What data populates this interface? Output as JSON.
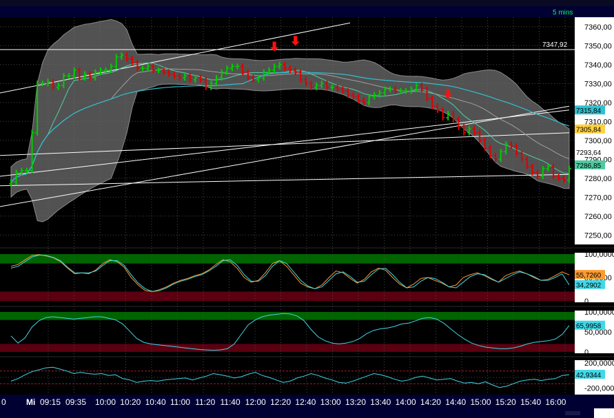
{
  "header": {
    "interval": "5 mins"
  },
  "colors": {
    "background": "#000000",
    "header_bar": "#000033",
    "axis_panel": "#ffffff",
    "bollinger_band": "#6e6e6e",
    "up_bar": "#00cc00",
    "down_bar": "#e00000",
    "ma_fast": "#50c8a0",
    "ma_mid": "#a0a0a0",
    "ma_slow": "#30c0d0",
    "trendline": "#ffffff",
    "osc_line_1": "#ff9a2e",
    "osc_line_2": "#40d8e8",
    "overbought_zone": "#006400",
    "oversold_zone": "#5a0010",
    "arrow": "#ff1010"
  },
  "time_axis": {
    "day_label": "Mi",
    "labels": [
      "09:15",
      "09:35",
      "10:00",
      "10:20",
      "10:40",
      "11:00",
      "11:20",
      "11:40",
      "12:00",
      "12:20",
      "12:40",
      "13:00",
      "13:20",
      "13:40",
      "14:00",
      "14:20",
      "14:40",
      "15:00",
      "15:20",
      "15:40",
      "16:00"
    ],
    "left_partial": "0"
  },
  "chart_data": [
    {
      "type": "ohlc",
      "pane": "price",
      "ylim": [
        7245,
        7365
      ],
      "y_ticks": [
        "7250,00",
        "7260,00",
        "7270,00",
        "7280,00",
        "7290,00",
        "7300,00",
        "7310,00",
        "7320,00",
        "7330,00",
        "7340,00",
        "7350,00",
        "7360,00"
      ],
      "price_labels": [
        {
          "text": "7347,92",
          "value": 7347.92
        },
        {
          "text": "7315,84",
          "value": 7315.84,
          "bg": "#30c0d0"
        },
        {
          "text": "7305,84",
          "value": 7305.84,
          "bg": "#ffd040"
        },
        {
          "text": "7293,64",
          "value": 7293.64,
          "bg": "#ffffff"
        },
        {
          "text": "7286,85",
          "value": 7286.85,
          "bg": "#50c8a0"
        }
      ],
      "horizontal_line": 7347.92,
      "close": [
        7278,
        7283,
        7284,
        7284,
        7304,
        7330,
        7330,
        7331,
        7328,
        7329,
        7334,
        7334,
        7337,
        7333,
        7335,
        7333,
        7336,
        7337,
        7337,
        7339,
        7344,
        7345,
        7343,
        7341,
        7338,
        7338,
        7339,
        7337,
        7337,
        7336,
        7335,
        7334,
        7333,
        7334,
        7332,
        7333,
        7332,
        7328,
        7330,
        7333,
        7336,
        7338,
        7339,
        7339,
        7336,
        7333,
        7332,
        7333,
        7336,
        7337,
        7339,
        7340,
        7338,
        7337,
        7336,
        7332,
        7330,
        7328,
        7329,
        7330,
        7328,
        7328,
        7327,
        7326,
        7324,
        7323,
        7321,
        7320,
        7323,
        7324,
        7325,
        7327,
        7327,
        7326,
        7326,
        7326,
        7327,
        7329,
        7327,
        7322,
        7318,
        7316,
        7312,
        7314,
        7311,
        7307,
        7304,
        7306,
        7304,
        7300,
        7296,
        7292,
        7290,
        7294,
        7298,
        7297,
        7293,
        7290,
        7286,
        7283,
        7281,
        7285,
        7286,
        7281,
        7280,
        7279,
        7285
      ],
      "arrows_down": [
        {
          "index": 50,
          "value": 7347
        },
        {
          "index": 54,
          "value": 7350
        },
        {
          "index": 83,
          "value": 7322
        }
      ]
    },
    {
      "type": "line",
      "pane": "stochastic",
      "ylim": [
        0,
        100
      ],
      "y_ticks": [
        "100,0000",
        "50,0000",
        "0"
      ],
      "zones": {
        "overbought": [
          80,
          100
        ],
        "oversold": [
          0,
          20
        ]
      },
      "series": [
        {
          "values": [
            74,
            78,
            88,
            97,
            99,
            96,
            92,
            84,
            70,
            58,
            60,
            58,
            66,
            80,
            88,
            84,
            72,
            50,
            34,
            22,
            20,
            24,
            30,
            38,
            44,
            48,
            54,
            58,
            66,
            78,
            88,
            84,
            70,
            50,
            40,
            44,
            60,
            80,
            86,
            74,
            56,
            38,
            30,
            26,
            34,
            50,
            64,
            60,
            48,
            38,
            46,
            62,
            70,
            66,
            50,
            36,
            28,
            36,
            48,
            50,
            44,
            38,
            30,
            34,
            50,
            56,
            60,
            54,
            46,
            40,
            54,
            60,
            64,
            58,
            50,
            44,
            46,
            54,
            62,
            55.726
          ]
        },
        {
          "values": [
            70,
            74,
            84,
            94,
            98,
            97,
            93,
            86,
            72,
            60,
            60,
            60,
            64,
            76,
            86,
            86,
            76,
            56,
            38,
            26,
            20,
            22,
            28,
            36,
            42,
            46,
            52,
            56,
            64,
            74,
            86,
            88,
            76,
            56,
            42,
            42,
            54,
            74,
            86,
            80,
            62,
            44,
            32,
            26,
            30,
            44,
            58,
            62,
            52,
            40,
            42,
            56,
            68,
            70,
            56,
            40,
            28,
            30,
            42,
            50,
            48,
            40,
            30,
            28,
            40,
            52,
            58,
            56,
            48,
            40,
            48,
            56,
            62,
            58,
            52,
            44,
            44,
            50,
            58,
            34.2902
          ]
        }
      ],
      "value_labels": [
        {
          "text": "55,7260",
          "value": 55.726,
          "bg": "#ff9a2e"
        },
        {
          "text": "34,2902",
          "value": 34.2902,
          "bg": "#40d8e8"
        }
      ]
    },
    {
      "type": "line",
      "pane": "rsi",
      "ylim": [
        0,
        100
      ],
      "y_ticks": [
        "100,0000",
        "50,0000",
        "0"
      ],
      "zones": {
        "overbought": [
          80,
          100
        ],
        "oversold": [
          0,
          20
        ]
      },
      "series": [
        {
          "values": [
            40,
            22,
            35,
            62,
            78,
            86,
            88,
            86,
            84,
            82,
            84,
            86,
            88,
            88,
            84,
            80,
            70,
            52,
            34,
            24,
            20,
            18,
            16,
            14,
            12,
            10,
            8,
            6,
            5,
            4,
            5,
            8,
            20,
            44,
            68,
            80,
            88,
            92,
            94,
            96,
            95,
            90,
            78,
            56,
            38,
            28,
            22,
            20,
            22,
            26,
            34,
            46,
            54,
            58,
            60,
            64,
            70,
            72,
            78,
            84,
            86,
            82,
            72,
            58,
            44,
            32,
            22,
            16,
            12,
            10,
            8,
            8,
            10,
            14,
            20,
            24,
            26,
            28,
            32,
            44,
            65.9958
          ]
        }
      ],
      "value_labels": [
        {
          "text": "65,9958",
          "value": 65.9958,
          "bg": "#40d8e8"
        }
      ]
    },
    {
      "type": "line",
      "pane": "cci",
      "ylim": [
        -250,
        250
      ],
      "y_ticks": [
        "200,0000",
        "0",
        "-200,0000"
      ],
      "zones": {
        "upper": 100,
        "lower": -100
      },
      "series": [
        {
          "values": [
            -60,
            -20,
            40,
            90,
            120,
            150,
            160,
            130,
            100,
            60,
            80,
            60,
            50,
            60,
            30,
            40,
            -20,
            -40,
            -80,
            -60,
            -50,
            -60,
            -40,
            -30,
            -20,
            -10,
            -40,
            -10,
            20,
            60,
            40,
            20,
            -10,
            10,
            50,
            80,
            30,
            0,
            -40,
            -80,
            -60,
            -10,
            20,
            60,
            30,
            -10,
            -40,
            -80,
            -90,
            -60,
            -20,
            20,
            60,
            40,
            10,
            -30,
            -60,
            -40,
            0,
            20,
            -10,
            -40,
            -30,
            -20,
            -60,
            -90,
            -80,
            -100,
            -70,
            -120,
            -160,
            -140,
            -100,
            -60,
            -40,
            -30,
            -50,
            -30,
            -20,
            30,
            42.9344
          ]
        }
      ],
      "value_labels": [
        {
          "text": "42,9344",
          "value": 42.9344,
          "bg": "#40d8e8"
        }
      ]
    }
  ]
}
